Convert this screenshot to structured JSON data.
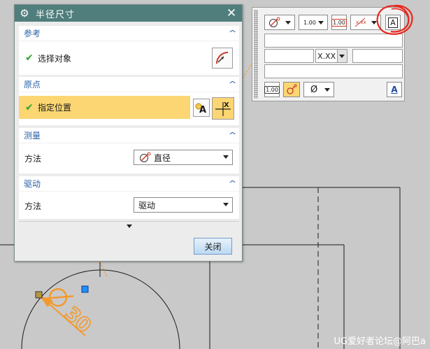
{
  "dialog": {
    "title": "半径尺寸",
    "groups": {
      "reference": {
        "title": "参考",
        "row_label": "选择对象"
      },
      "origin": {
        "title": "原点",
        "row_label": "指定位置"
      },
      "measure": {
        "title": "测量",
        "method_label": "方法",
        "method_value": "直径"
      },
      "drive": {
        "title": "驱动",
        "method_label": "方法",
        "method_value": "驱动"
      }
    },
    "close_button": "关闭"
  },
  "toolbar": {
    "precision_value": "1.00",
    "tolerance_value": "X.XX",
    "boxed_value": "1.00",
    "prefix_symbol": "Ø"
  },
  "drawing": {
    "dimension_text": "Ø30",
    "accent_color": "#f39a2e",
    "line_color": "#1a1a1a",
    "highlight_color": "#fbd672"
  },
  "watermark": "UG爱好者论坛@阿巴a"
}
